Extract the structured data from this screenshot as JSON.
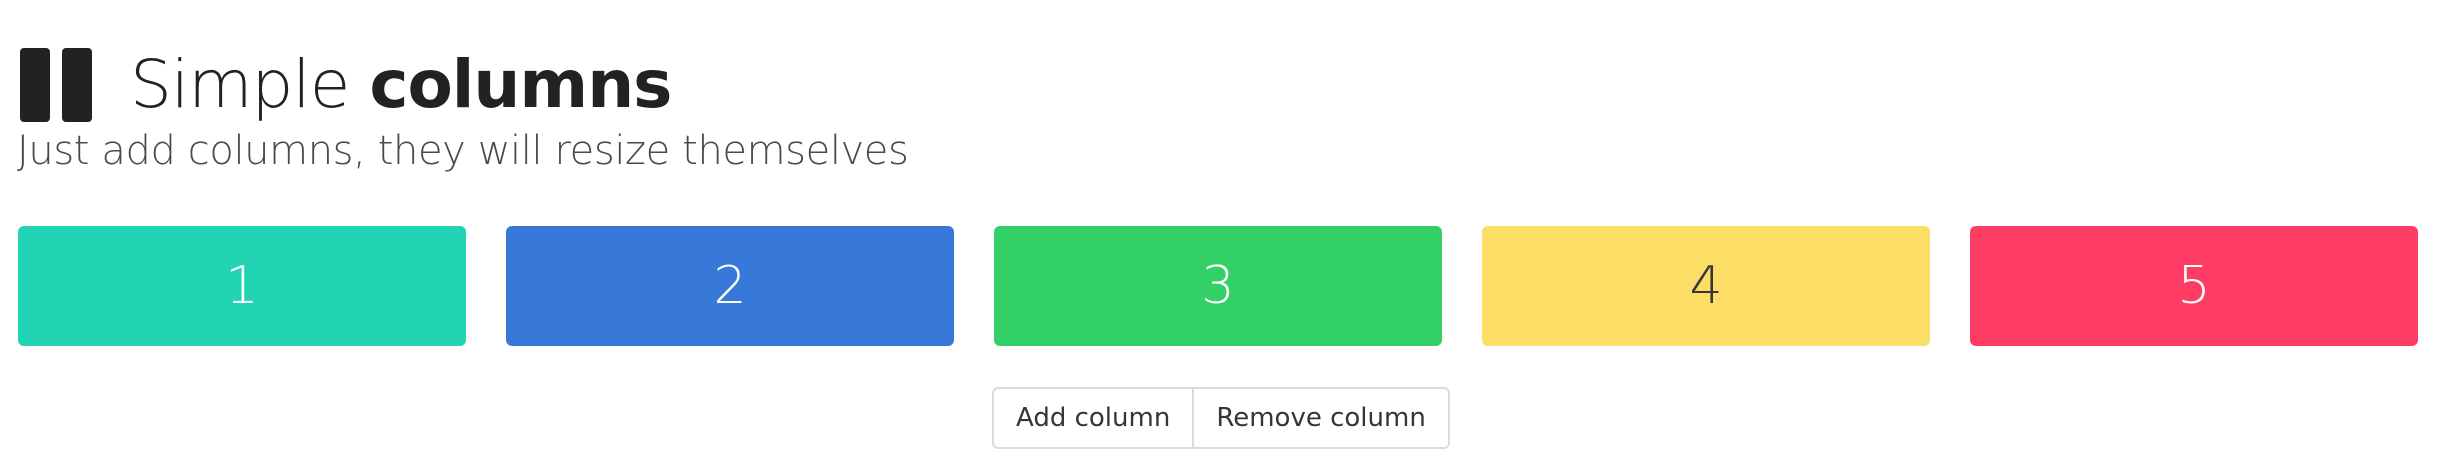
{
  "header": {
    "icon": "columns-icon",
    "title_light": "Simple ",
    "title_bold": "columns",
    "subtitle": "Just add columns, they will resize themselves"
  },
  "columns": [
    {
      "label": "1",
      "color": "#22d3b4",
      "text_color": "#ffffff"
    },
    {
      "label": "2",
      "color": "#3878d9",
      "text_color": "#ffffff"
    },
    {
      "label": "3",
      "color": "#32d067",
      "text_color": "#ffffff"
    },
    {
      "label": "4",
      "color": "#fcdd66",
      "text_color": "#363636"
    },
    {
      "label": "5",
      "color": "#ff3c64",
      "text_color": "#ffffff"
    }
  ],
  "buttons": {
    "add_label": "Add column",
    "remove_label": "Remove column"
  }
}
